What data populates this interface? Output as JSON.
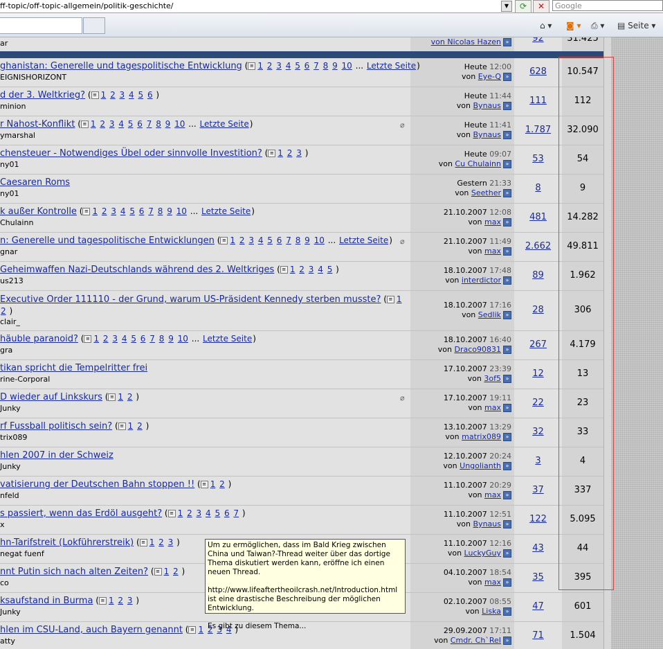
{
  "browser": {
    "address": "ff-topic/off-topic-allgemein/politik-geschichte/",
    "search_placeholder": "Google",
    "page_label": "Seite"
  },
  "top_partial": {
    "author": "ar",
    "last_by": "von Nicolas Hazen",
    "replies": "92",
    "views": "31.425"
  },
  "threads": [
    {
      "title": "ghanistan: Generelle und tagespolitische Entwicklung",
      "pages": [
        "1",
        "2",
        "3",
        "4",
        "5",
        "6",
        "7",
        "8",
        "9",
        "10"
      ],
      "last_page": "Letzte Seite",
      "ellipsis": "...",
      "author": "EIGNISHORIZONT",
      "date": "Heute",
      "time": "12:00",
      "by": "Eye-Q",
      "replies": "628",
      "views": "10.547",
      "clip": false
    },
    {
      "title": "d der 3. Weltkrieg?",
      "pages": [
        "1",
        "2",
        "3",
        "4",
        "5",
        "6"
      ],
      "last_page": "",
      "ellipsis": "",
      "author": "minion",
      "date": "Heute",
      "time": "11:44",
      "by": "Bynaus",
      "replies": "111",
      "views": "112",
      "clip": false
    },
    {
      "title": "r Nahost-Konflikt",
      "pages": [
        "1",
        "2",
        "3",
        "4",
        "5",
        "6",
        "7",
        "8",
        "9",
        "10"
      ],
      "last_page": "Letzte Seite",
      "ellipsis": "...",
      "author": "ymarshal",
      "date": "Heute",
      "time": "11:41",
      "by": "Bynaus",
      "replies": "1.787",
      "views": "32.090",
      "clip": true
    },
    {
      "title": "chensteuer - Notwendiges Übel oder sinnvolle Investition?",
      "pages": [
        "1",
        "2",
        "3"
      ],
      "last_page": "",
      "ellipsis": "",
      "author": "ny01",
      "date": "Heute",
      "time": "09:07",
      "by": "Cu Chulainn",
      "replies": "53",
      "views": "54",
      "clip": false
    },
    {
      "title": " Caesaren Roms",
      "pages": [],
      "last_page": "",
      "ellipsis": "",
      "author": "ny01",
      "date": "Gestern",
      "time": "21:33",
      "by": "Seether",
      "replies": "8",
      "views": "9",
      "clip": false
    },
    {
      "title": "k außer Kontrolle",
      "pages": [
        "1",
        "2",
        "3",
        "4",
        "5",
        "6",
        "7",
        "8",
        "9",
        "10"
      ],
      "last_page": "Letzte Seite",
      "ellipsis": "...",
      "author": "Chulainn",
      "date": "21.10.2007",
      "time": "12:08",
      "by": "max",
      "replies": "481",
      "views": "14.282",
      "clip": false
    },
    {
      "title": "n: Generelle und tagespolitische Entwicklungen",
      "pages": [
        "1",
        "2",
        "3",
        "4",
        "5",
        "6",
        "7",
        "8",
        "9",
        "10"
      ],
      "last_page": "Letzte Seite",
      "ellipsis": "...",
      "author": "gnar",
      "date": "21.10.2007",
      "time": "11:49",
      "by": "max",
      "replies": "2.662",
      "views": "49.811",
      "clip": true
    },
    {
      "title": " Geheimwaffen Nazi-Deutschlands während des 2. Weltkriges",
      "pages": [
        "1",
        "2",
        "3",
        "4",
        "5"
      ],
      "last_page": "",
      "ellipsis": "",
      "author": "us213",
      "date": "18.10.2007",
      "time": "17:48",
      "by": "interdictor",
      "replies": "89",
      "views": "1.962",
      "clip": false
    },
    {
      "title": " Executive Order 111110 - der Grund, warum US-Präsident Kennedy sterben musste?",
      "pages": [
        "1",
        "2"
      ],
      "last_page": "",
      "ellipsis": "",
      "author": "clair_",
      "date": "18.10.2007",
      "time": "17:16",
      "by": "Sedlik",
      "replies": "28",
      "views": "306",
      "clip": false,
      "tall": true
    },
    {
      "title": "häuble paranoid?",
      "pages": [
        "1",
        "2",
        "3",
        "4",
        "5",
        "6",
        "7",
        "8",
        "9",
        "10"
      ],
      "last_page": "Letzte Seite",
      "ellipsis": "...",
      "author": "gra",
      "date": "18.10.2007",
      "time": "16:40",
      "by": "Draco90831",
      "replies": "267",
      "views": "4.179",
      "clip": false
    },
    {
      "title": "tikan spricht die Tempelritter frei",
      "pages": [],
      "last_page": "",
      "ellipsis": "",
      "author": "rine-Corporal",
      "date": "17.10.2007",
      "time": "23:39",
      "by": "3of5",
      "replies": "12",
      "views": "13",
      "clip": false
    },
    {
      "title": "D wieder auf Linkskurs",
      "pages": [
        "1",
        "2"
      ],
      "last_page": "",
      "ellipsis": "",
      "author": "Junky",
      "date": "17.10.2007",
      "time": "19:11",
      "by": "max",
      "replies": "22",
      "views": "23",
      "clip": true
    },
    {
      "title": "rf Fussball politisch sein?",
      "pages": [
        "1",
        "2"
      ],
      "last_page": "",
      "ellipsis": "",
      "author": "trix089",
      "date": "13.10.2007",
      "time": "13:29",
      "by": "matrix089",
      "replies": "32",
      "views": "33",
      "clip": false
    },
    {
      "title": "hlen 2007 in der Schweiz",
      "pages": [],
      "last_page": "",
      "ellipsis": "",
      "author": "Junky",
      "date": "12.10.2007",
      "time": "20:24",
      "by": "Ungolianth",
      "replies": "3",
      "views": "4",
      "clip": false
    },
    {
      "title": "vatisierung der Deutschen Bahn stoppen !!",
      "pages": [
        "1",
        "2"
      ],
      "last_page": "",
      "ellipsis": "",
      "author": "nfeld",
      "date": "11.10.2007",
      "time": "20:29",
      "by": "max",
      "replies": "37",
      "views": "337",
      "clip": false
    },
    {
      "title": "s passiert, wenn das Erdöl ausgeht?",
      "pages": [
        "1",
        "2",
        "3",
        "4",
        "5",
        "6",
        "7"
      ],
      "last_page": "",
      "ellipsis": "",
      "author": "x",
      "date": "11.10.2007",
      "time": "12:51",
      "by": "Bynaus",
      "replies": "122",
      "views": "5.095",
      "clip": false
    },
    {
      "title": "hn-Tarifstreit (Lokführerstreik)",
      "pages": [
        "1",
        "2",
        "3"
      ],
      "last_page": "",
      "ellipsis": "",
      "author": "negat fuenf",
      "date": "11.10.2007",
      "time": "12:16",
      "by": "LuckyGuy",
      "replies": "43",
      "views": "44",
      "clip": false
    },
    {
      "title": "nnt Putin sich nach alten Zeiten?",
      "pages": [
        "1",
        "2"
      ],
      "last_page": "",
      "ellipsis": "",
      "author": "co",
      "date": "04.10.2007",
      "time": "18:54",
      "by": "max",
      "replies": "35",
      "views": "395",
      "clip": false
    },
    {
      "title": "ksaufstand in Burma",
      "pages": [
        "1",
        "2",
        "3"
      ],
      "last_page": "",
      "ellipsis": "",
      "author": "Junky",
      "date": "02.10.2007",
      "time": "08:55",
      "by": "Liska",
      "replies": "47",
      "views": "601",
      "clip": false
    },
    {
      "title": "hlen im CSU-Land, auch Bayern genannt",
      "pages": [
        "1",
        "2",
        "3",
        "4"
      ],
      "last_page": "",
      "ellipsis": "",
      "author": "atty",
      "date": "29.09.2007",
      "time": "17:11",
      "by": "Cmdr. Ch`ReI",
      "replies": "71",
      "views": "1.504",
      "clip": false
    }
  ],
  "von": "von",
  "tooltip": {
    "line1": "Um zu ermöglichen, dass im  Bald Krieg zwischen China und Taiwan?-Thread weiter über das dortige Thema diskutiert werden kann, eröffne ich einen neuen Thread.",
    "line2": "http://www.lifeaftertheoilcrash.net/Introduction.html ist eine drastische Beschreibung der möglichen Entwicklung.",
    "line3": "Es gibt zu diesem Thema..."
  }
}
